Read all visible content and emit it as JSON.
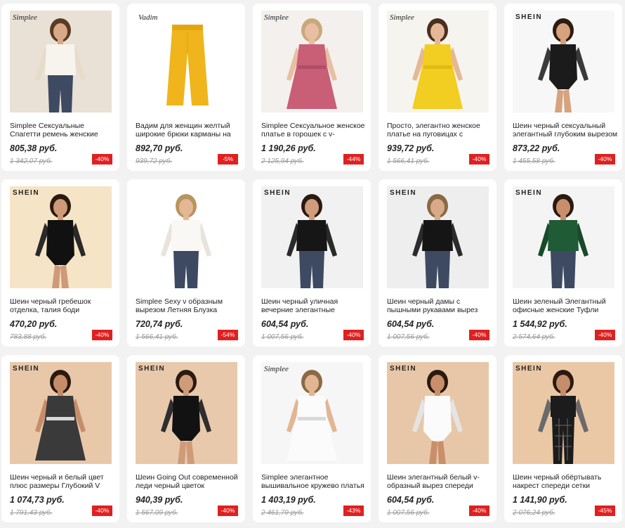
{
  "colors": {
    "discount_badge": "#e02020",
    "card_bg": "#ffffff",
    "page_bg": "#f2f2f2"
  },
  "products": [
    {
      "brand": "Simplee",
      "brand_style": "script",
      "title": "Simplee Сексуальные Спагетти ремень женские cami Топы",
      "price": "805,38 руб.",
      "old_price": "1 342,07 руб.",
      "discount": "-40%",
      "image": "model-white-cami-top"
    },
    {
      "brand": "Vadim",
      "brand_style": "script",
      "title": "Вадим для женщин желтый широкие брюки карманы на",
      "price": "892,70 руб.",
      "old_price": "939,72 руб.",
      "discount": "-5%",
      "image": "yellow-wide-pants"
    },
    {
      "brand": "Simplee",
      "brand_style": "script",
      "title": "Simplee Сексуальное женское платье в горошек с v-",
      "price": "1 190,26 руб.",
      "old_price": "2 125,94 руб.",
      "discount": "-44%",
      "image": "model-pink-dress"
    },
    {
      "brand": "Simplee",
      "brand_style": "script",
      "title": "Просто, элегантно женское платье на пуговицах с",
      "price": "939,72 руб.",
      "old_price": "1 566,41 руб.",
      "discount": "-40%",
      "image": "yellow-button-dress"
    },
    {
      "brand": "SHEIN",
      "brand_style": "bold",
      "title": "Шеин черный сексуальный элегантный глубоким вырезом",
      "price": "873,22 руб.",
      "old_price": "1 455,58 руб.",
      "discount": "-40%",
      "image": "model-black-mesh-bodysuit"
    },
    {
      "brand": "SHEIN",
      "brand_style": "bold",
      "title": "Шеин черный гребешок отделка, талия боди",
      "price": "470,20 руб.",
      "old_price": "783,88 руб.",
      "discount": "-40%",
      "image": "model-black-scallop-bodysuit"
    },
    {
      "brand": "",
      "brand_style": "none",
      "title": "Simplee Sexy v образным вырезом Летняя Блузка",
      "price": "720,74 руб.",
      "old_price": "1 566,41 руб.",
      "discount": "-54%",
      "image": "model-white-blouse"
    },
    {
      "brand": "SHEIN",
      "brand_style": "bold",
      "title": "Шеин черный уличная вечерние элегантные",
      "price": "604,54 руб.",
      "old_price": "1 007,56 руб.",
      "discount": "-40%",
      "image": "model-black-cutout-top"
    },
    {
      "brand": "SHEIN",
      "brand_style": "bold",
      "title": "Шеин черный дамы с пышными рукавами вырез",
      "price": "604,54 руб.",
      "old_price": "1 007,56 руб.",
      "discount": "-40%",
      "image": "model-black-puff-top"
    },
    {
      "brand": "SHEIN",
      "brand_style": "bold",
      "title": "Шеин зеленый Элегантный офисные женские Туфли",
      "price": "1 544,92 руб.",
      "old_price": "2 574,64 руб.",
      "discount": "-40%",
      "image": "model-green-wrap-top"
    },
    {
      "brand": "SHEIN",
      "brand_style": "bold",
      "title": "Шеин черный и белый цвет плюс размеры Глубокий V",
      "price": "1 074,73 руб.",
      "old_price": "1 791,43 руб.",
      "discount": "-40%",
      "image": "model-striped-wrap-dress"
    },
    {
      "brand": "SHEIN",
      "brand_style": "bold",
      "title": "Шеин Going Out современной леди черный цветок",
      "price": "940,39 руб.",
      "old_price": "1 567,09 руб.",
      "discount": "-40%",
      "image": "model-black-flower-bodysuit"
    },
    {
      "brand": "Simplee",
      "brand_style": "script",
      "title": "Simplee элегантное вышивальное кружево платья",
      "price": "1 403,19 руб.",
      "old_price": "2 461,79 руб.",
      "discount": "-43%",
      "image": "model-white-lace-dress"
    },
    {
      "brand": "SHEIN",
      "brand_style": "bold",
      "title": "Шеин элегантный белый v-образный вырез спереди",
      "price": "604,54 руб.",
      "old_price": "1 007,56 руб.",
      "discount": "-40%",
      "image": "model-white-bodysuit"
    },
    {
      "brand": "SHEIN",
      "brand_style": "bold",
      "title": "Шеин черный обёртывать накрест спереди сетки",
      "price": "1 141,90 руб.",
      "old_price": "2 076,24 руб.",
      "discount": "-45%",
      "image": "model-black-check-set"
    }
  ]
}
